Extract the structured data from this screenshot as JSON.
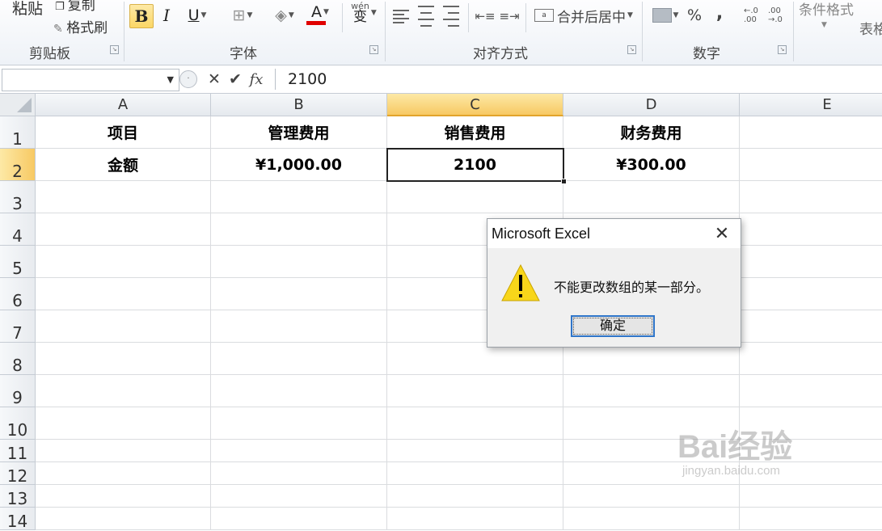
{
  "ribbon": {
    "clipboard": {
      "paste": "粘贴",
      "copy": "复制",
      "format_painter": "格式刷",
      "label": "剪贴板"
    },
    "font": {
      "bold": "B",
      "italic": "I",
      "underline": "U",
      "font_color": "A",
      "wen": "wén",
      "bian": "变",
      "label": "字体"
    },
    "alignment": {
      "merge_center": "合并后居中",
      "label": "对齐方式"
    },
    "number": {
      "percent": "%",
      "comma": ",",
      "increase_decimal": "←.0 .00",
      "decrease_decimal": ".00 →.0",
      "label": "数字"
    },
    "styles": {
      "conditional_format": "条件格式",
      "table": "表格"
    }
  },
  "formula_bar": {
    "name_box": "",
    "cancel": "✕",
    "enter": "✔",
    "fx": "fx",
    "value": "2100"
  },
  "grid": {
    "columns": [
      "A",
      "B",
      "C",
      "D",
      "E"
    ],
    "selected_column": "C",
    "rows": [
      "1",
      "2",
      "3",
      "4",
      "5",
      "6",
      "7",
      "8",
      "9",
      "10",
      "11",
      "12",
      "13",
      "14"
    ],
    "selected_row": "2",
    "cells": {
      "A1": "项目",
      "B1": "管理费用",
      "C1": "销售费用",
      "D1": "财务费用",
      "A2": "金额",
      "B2": "¥1,000.00",
      "C2": "2100",
      "D2": "¥300.00"
    }
  },
  "dialog": {
    "title": "Microsoft Excel",
    "message": "不能更改数组的某一部分。",
    "ok_label": "确定"
  },
  "watermark": {
    "big": "Bai经验",
    "small": "jingyan.baidu.com"
  },
  "colors": {
    "selection_header": "#fbd766",
    "warning_icon": "#f8d61a",
    "ok_border": "#2f75c9",
    "font_color_bar": "#e00000"
  }
}
